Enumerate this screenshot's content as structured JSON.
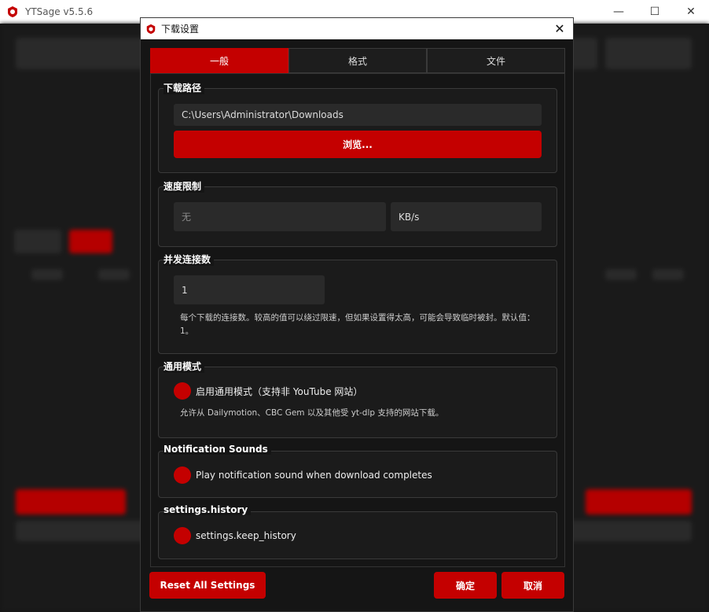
{
  "main_window": {
    "title": "YTSage  v5.5.6",
    "minimize_glyph": "—",
    "maximize_glyph": "☐",
    "close_glyph": "✕"
  },
  "dialog": {
    "title": "下载设置",
    "close_glyph": "✕",
    "tabs": [
      {
        "label": "一般"
      },
      {
        "label": "格式"
      },
      {
        "label": "文件"
      }
    ],
    "download_path": {
      "title": "下载路径",
      "value": "C:\\Users\\Administrator\\Downloads",
      "browse_label": "浏览..."
    },
    "speed_limit": {
      "title": "速度限制",
      "value_placeholder": "无",
      "unit": "KB/s"
    },
    "concurrent": {
      "title": "并发连接数",
      "value": "1",
      "help": "每个下载的连接数。较高的值可以绕过限速，但如果设置得太高，可能会导致临时被封。默认值：1。"
    },
    "generic_mode": {
      "title": "通用模式",
      "checkbox_label": "启用通用模式（支持非 YouTube 网站）",
      "help": "允许从 Dailymotion、CBC Gem 以及其他受 yt-dlp 支持的网站下载。"
    },
    "notification_sounds": {
      "title": "Notification Sounds",
      "checkbox_label": "Play notification sound when download completes"
    },
    "history": {
      "title": "settings.history",
      "checkbox_label": "settings.keep_history"
    },
    "footer": {
      "reset_label": "Reset All Settings",
      "ok_label": "确定",
      "cancel_label": "取消"
    }
  },
  "colors": {
    "accent": "#c40000",
    "background": "#151515",
    "field": "#2a2a2a"
  }
}
